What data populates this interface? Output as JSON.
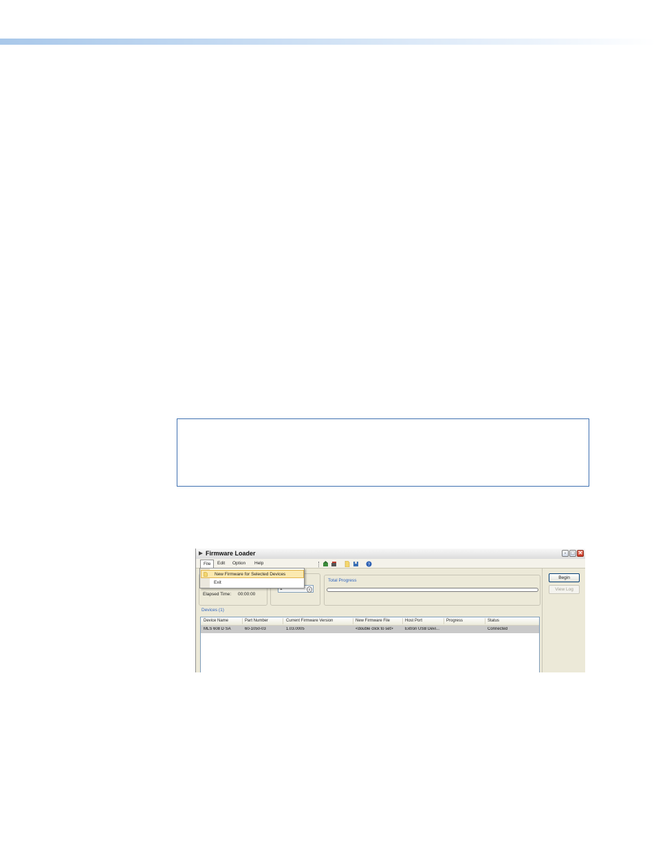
{
  "window": {
    "title": "Firmware Loader",
    "minimize_glyph": "-",
    "maximize_glyph": "□",
    "close_glyph": "✕"
  },
  "menu": {
    "file": "File",
    "edit": "Edit",
    "option": "Option",
    "help": "Help"
  },
  "file_menu": {
    "items": [
      {
        "label": "New Firmware for Selected Devices",
        "icon": "new-file-icon",
        "highlighted": true
      },
      {
        "label": "Exit",
        "highlighted": false
      }
    ]
  },
  "toolbar": {
    "icons": [
      "add-device-icon",
      "remove-device-icon",
      "new-file-icon",
      "save-icon",
      "help-icon"
    ]
  },
  "status": {
    "elapsed_label": "Elapsed Time:",
    "elapsed_value": "00:00:00",
    "spinner_value": "1"
  },
  "total_progress": {
    "label": "Total Progress",
    "value": 0
  },
  "buttons": {
    "begin": "Begin",
    "view_log": "View Log"
  },
  "devices": {
    "label": "Devices (1)",
    "columns": [
      "Device Name",
      "Part Number",
      "Current Firmware Version",
      "New Firmware File",
      "Host Port",
      "Progress",
      "Status"
    ],
    "rows": [
      [
        "MLS 608 D SA",
        "60-1050-03",
        "1.03.0005",
        "<double click to set>",
        "Extron USB Devi...",
        "",
        "Connected"
      ]
    ]
  },
  "colors": {
    "accent_bar": "#a9c8ea",
    "note_border": "#3d6fb0",
    "group_label": "#2f64c0",
    "menu_highlight": "#fbe9b0"
  }
}
